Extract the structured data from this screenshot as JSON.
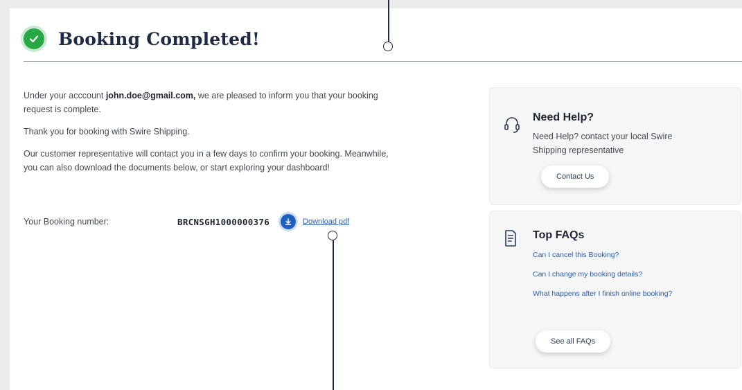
{
  "header": {
    "title": "Booking Completed!"
  },
  "message": {
    "p1_prefix": "Under your acccount ",
    "email": "john.doe@gmail.com,",
    "p1_suffix": " we are pleased to inform you that your booking request is complete.",
    "p2": "Thank you for booking with Swire Shipping.",
    "p3": "Our customer representative will contact you in a few days to confirm your booking. Meanwhile, you can also download the documents below, or start exploring your dashboard!"
  },
  "booking": {
    "label": "Your Booking number:",
    "number": "BRCNSGH1000000376",
    "download_label": "Download pdf"
  },
  "help": {
    "title": "Need Help?",
    "description": "Need Help? contact your local Swire Shipping representative",
    "button": "Contact Us"
  },
  "faq": {
    "title": "Top FAQs",
    "links": [
      "Can I cancel this Booking?",
      "Can I change my booking details?",
      "What happens after I finish online booking?"
    ],
    "button": "See all FAQs"
  },
  "colors": {
    "success": "#27a845",
    "brand_navy": "#1f2a44",
    "link_blue": "#2a5db0",
    "download_blue": "#1f5fbf"
  },
  "icons": [
    "check-icon",
    "download-icon",
    "headset-icon",
    "faq-document-icon"
  ]
}
